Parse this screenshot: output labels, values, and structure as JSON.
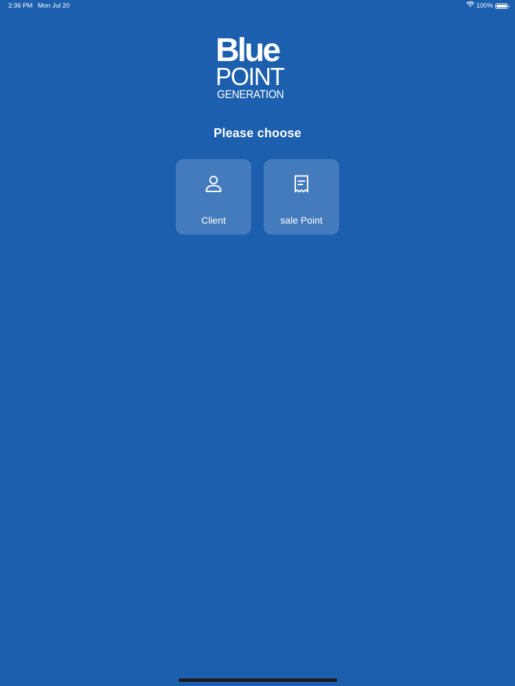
{
  "status_bar": {
    "time": "2:36 PM",
    "date": "Mon Jul 20",
    "battery_text": "100%",
    "battery_level": 1.0,
    "wifi_icon": "wifi-icon"
  },
  "logo": {
    "line1": "Blue",
    "line2": "POINT",
    "line3": "GENERATION"
  },
  "heading": "Please choose",
  "options": [
    {
      "label": "Client",
      "icon": "person-icon"
    },
    {
      "label": "sale Point",
      "icon": "receipt-icon"
    }
  ],
  "colors": {
    "background": "#1b5fae",
    "card": "rgba(255,255,255,0.18)",
    "text": "#ffffff"
  }
}
